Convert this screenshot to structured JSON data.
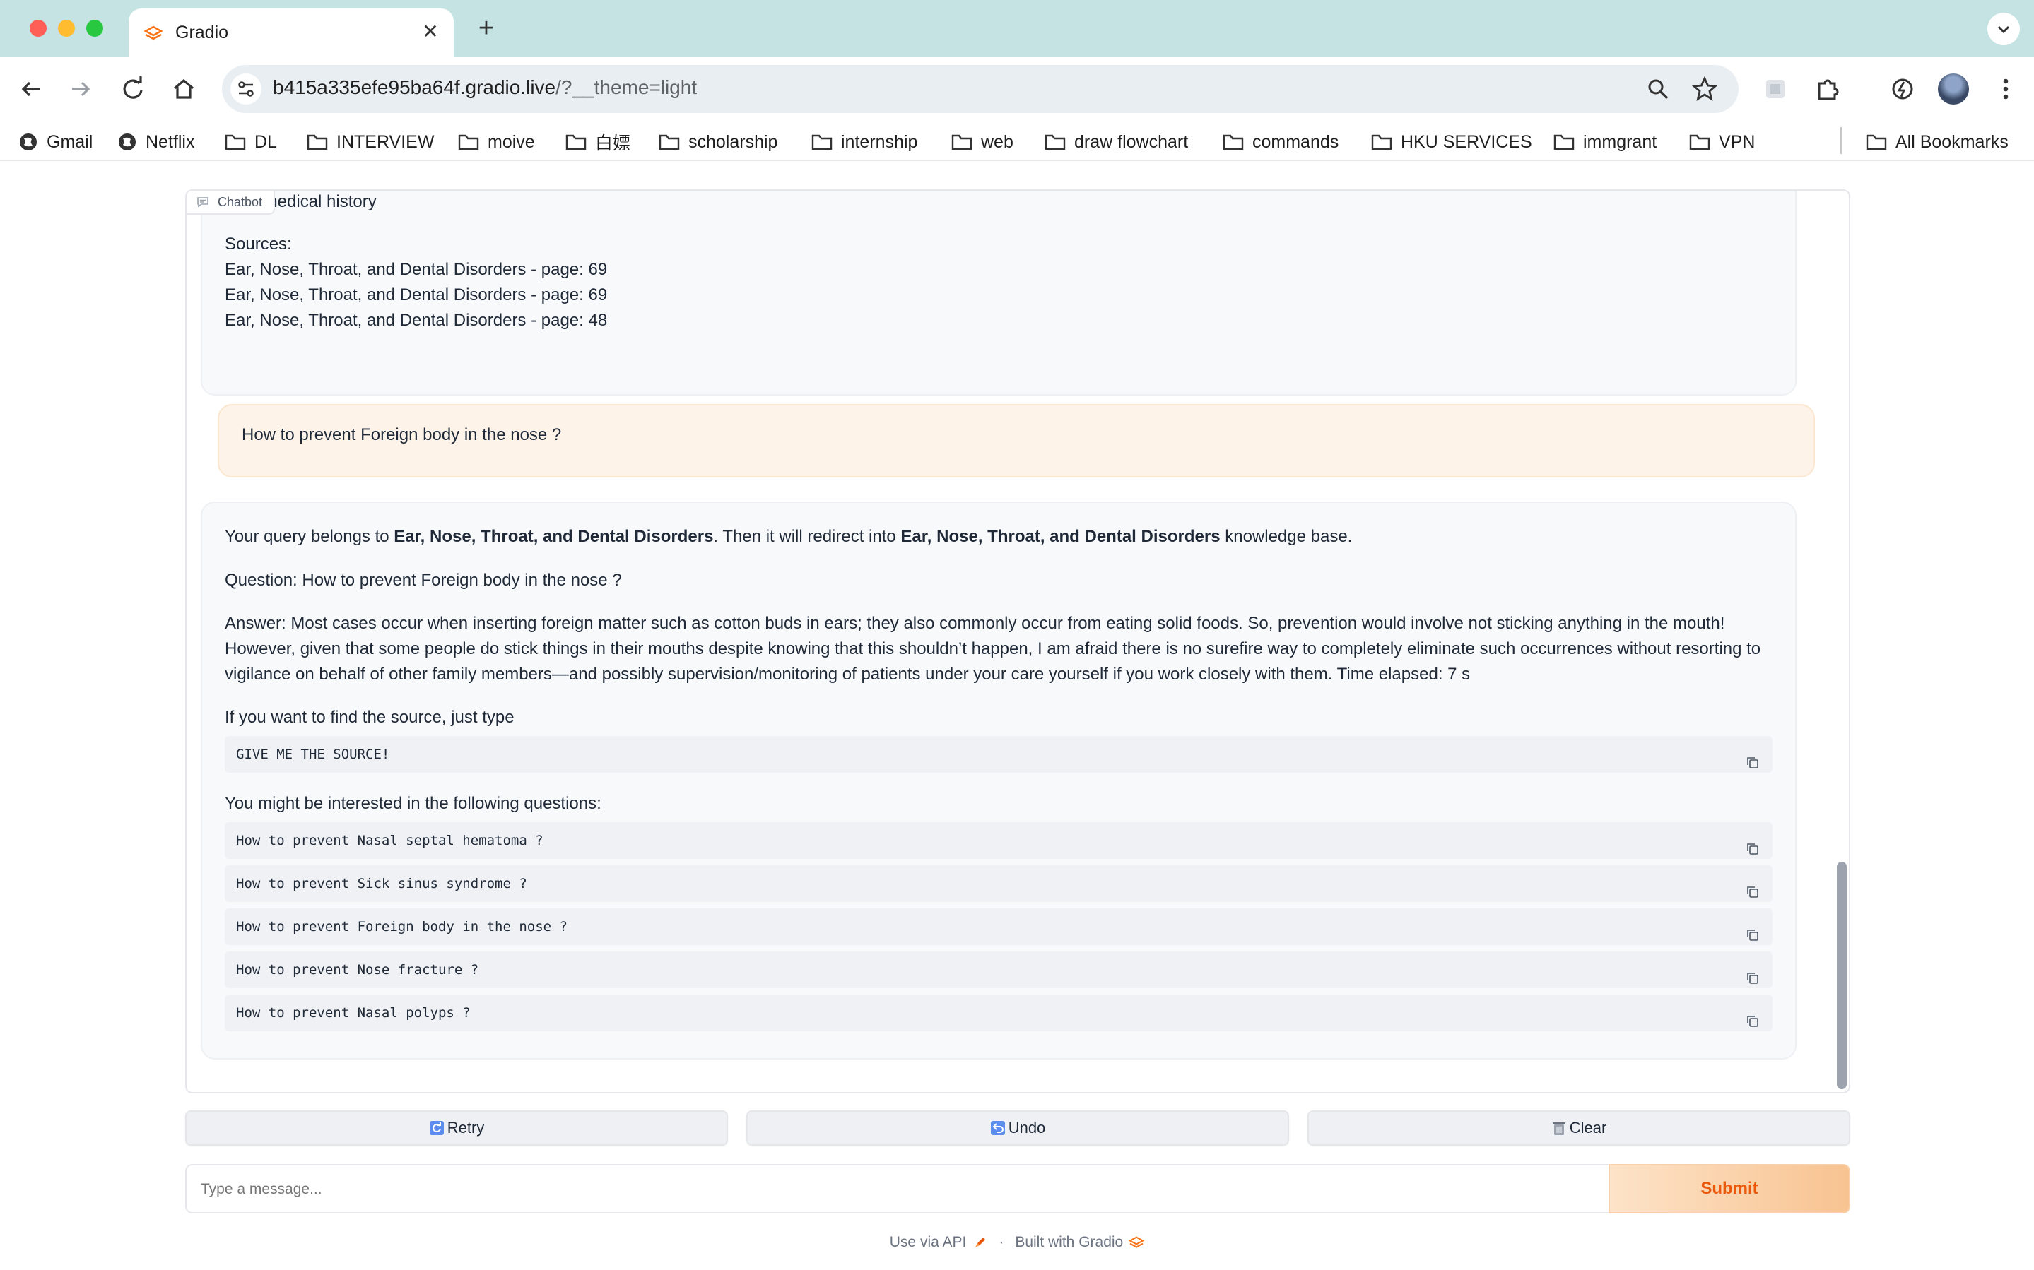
{
  "browser": {
    "tab_title": "Gradio",
    "url_host": "b415a335efe95ba64f.gradio.live",
    "url_path": "/?__theme=light",
    "bookmarks": [
      "Gmail",
      "Netflix",
      "DL",
      "INTERVIEW",
      "moive",
      "白嫖",
      "scholarship",
      "internship",
      "web",
      "draw flowchart",
      "commands",
      "HKU SERVICES",
      "immgrant",
      "VPN"
    ],
    "all_bookmarks": "All Bookmarks"
  },
  "chatbot": {
    "label": "Chatbot",
    "prev_bot": {
      "partial_line": "Past medical history",
      "sources_label": "Sources:",
      "sources": [
        "Ear, Nose, Throat, and Dental Disorders - page: 69",
        "Ear, Nose, Throat, and Dental Disorders - page: 69",
        "Ear, Nose, Throat, and Dental Disorders - page: 48"
      ]
    },
    "user_message": "How to prevent Foreign body in the nose ?",
    "bot": {
      "query_prefix": "Your query belongs to ",
      "category": "Ear, Nose, Throat, and Dental Disorders",
      "query_middle": ". Then it will redirect into ",
      "kb": "Ear, Nose, Throat, and Dental Disorders",
      "query_suffix": " knowledge base.",
      "question": "Question: How to prevent Foreign body in the nose ?",
      "answer_lines": [
        "Answer: Most cases occur when inserting foreign matter such as cotton buds in ears; they also commonly occur from eating solid foods. So, prevention would involve not sticking anything in the mouth!",
        "However, given that some people do stick things in their mouths despite knowing that this shouldn’t happen, I am afraid there is no surefire way to completely eliminate such occurrences without resorting to",
        "vigilance on behalf of other family members—and possibly supervision/monitoring of patients under your care yourself if you work closely with them. Time elapsed: 7 s"
      ],
      "source_hint": "If you want to find the source, just type",
      "source_code": "GIVE ME THE SOURCE!",
      "interest_label": "You might be interested in the following questions:",
      "suggestions": [
        "How to prevent Nasal septal hematoma ?",
        "How to prevent Sick sinus syndrome ?",
        "How to prevent Foreign body in the nose ?",
        "How to prevent Nose fracture ?",
        "How to prevent Nasal polyps ?"
      ]
    }
  },
  "buttons": {
    "retry": "Retry",
    "undo": "Undo",
    "clear": "Clear",
    "submit": "Submit"
  },
  "input": {
    "placeholder": "Type a message..."
  },
  "footer": {
    "api": "Use via API",
    "sep": "·",
    "built": "Built with Gradio"
  },
  "colors": {
    "accent": "#ea580c",
    "user_bubble": "#fdf3e8",
    "bot_bubble": "#f8f9fb",
    "tabbar": "#c4e3e2"
  }
}
